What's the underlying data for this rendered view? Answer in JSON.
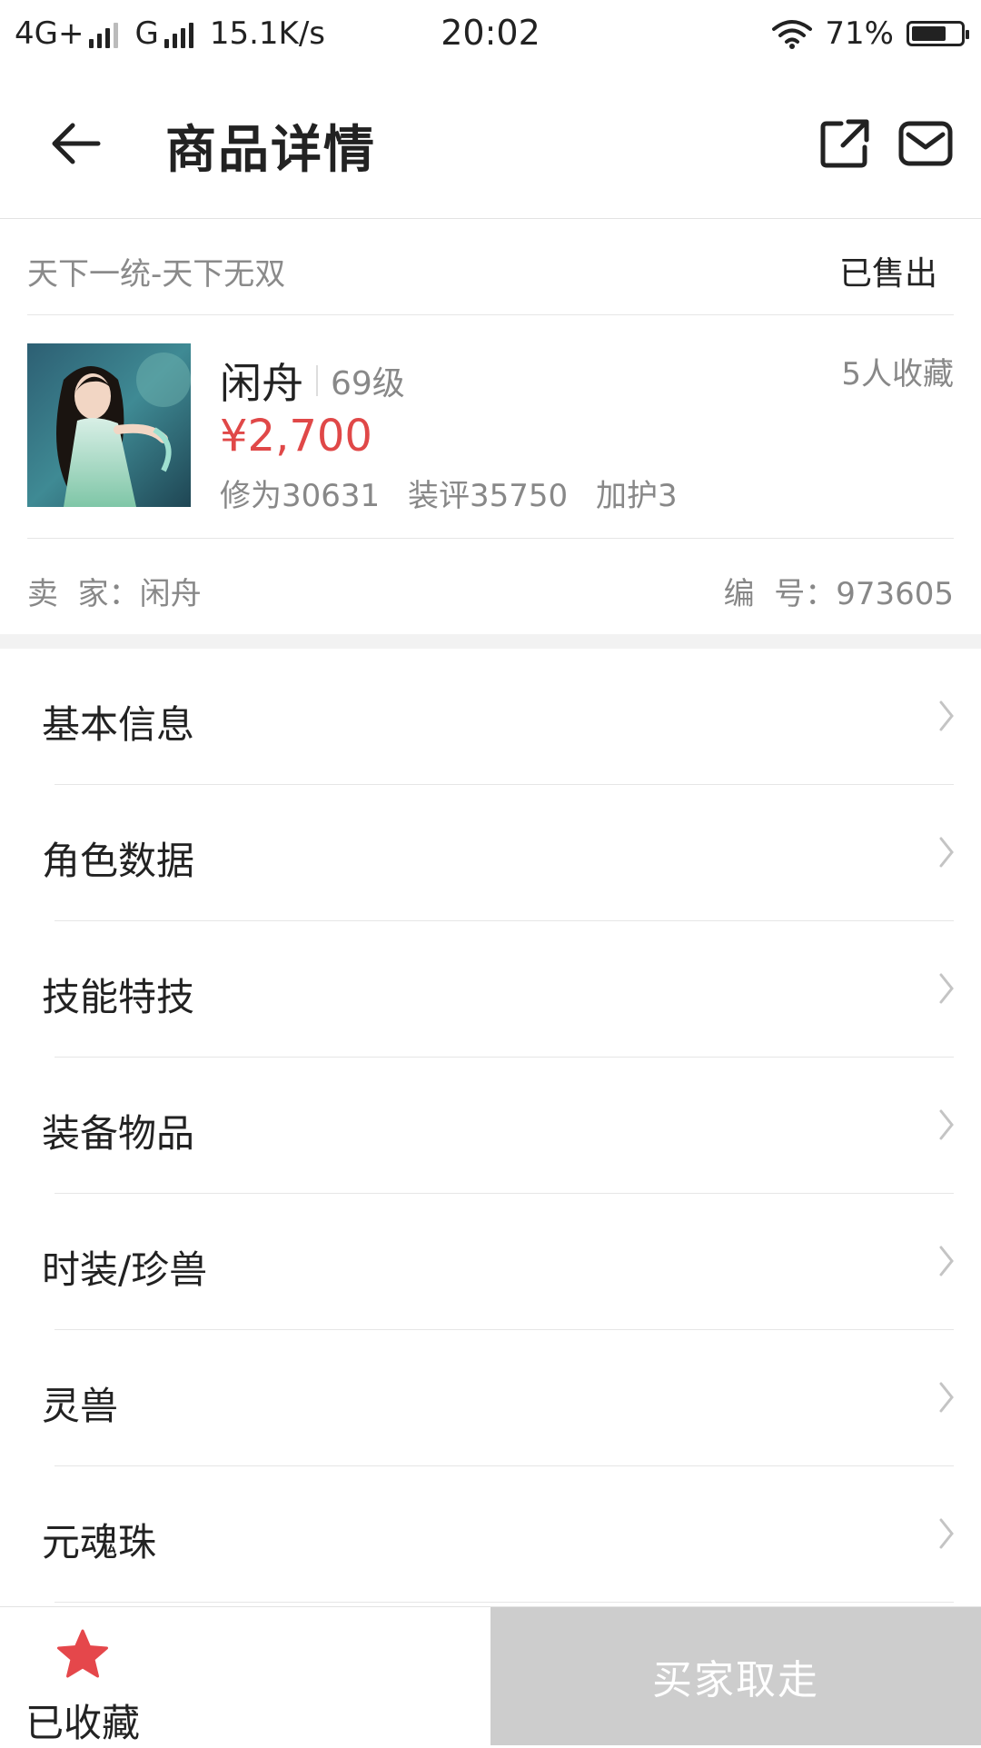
{
  "status_bar": {
    "network1": "4G+",
    "network2": "G",
    "speed": "15.1K/s",
    "time": "20:02",
    "battery": "71%",
    "battery_level": 0.71
  },
  "header": {
    "title": "商品详情",
    "back_icon": "arrow-left-icon",
    "share_icon": "share-icon",
    "mail_icon": "mail-icon"
  },
  "listing": {
    "server": "天下一统-天下无双",
    "status": "已售出",
    "name": "闲舟",
    "level": "69级",
    "favorites": "5人收藏",
    "price": "¥2,700",
    "stats": [
      "修为30631",
      "装评35750",
      "加护3"
    ],
    "seller": "卖  家：闲舟",
    "serial": "编  号：973605"
  },
  "menu": {
    "items": [
      {
        "label": "基本信息"
      },
      {
        "label": "角色数据"
      },
      {
        "label": "技能特技"
      },
      {
        "label": "装备物品"
      },
      {
        "label": "时装/珍兽"
      },
      {
        "label": "灵兽"
      },
      {
        "label": "元魂珠"
      }
    ]
  },
  "bottom": {
    "favorite_label": "已收藏",
    "action_label": "买家取走"
  },
  "colors": {
    "price": "#e04848",
    "star": "#e5474b",
    "disabled_button": "#cdcdcd"
  }
}
